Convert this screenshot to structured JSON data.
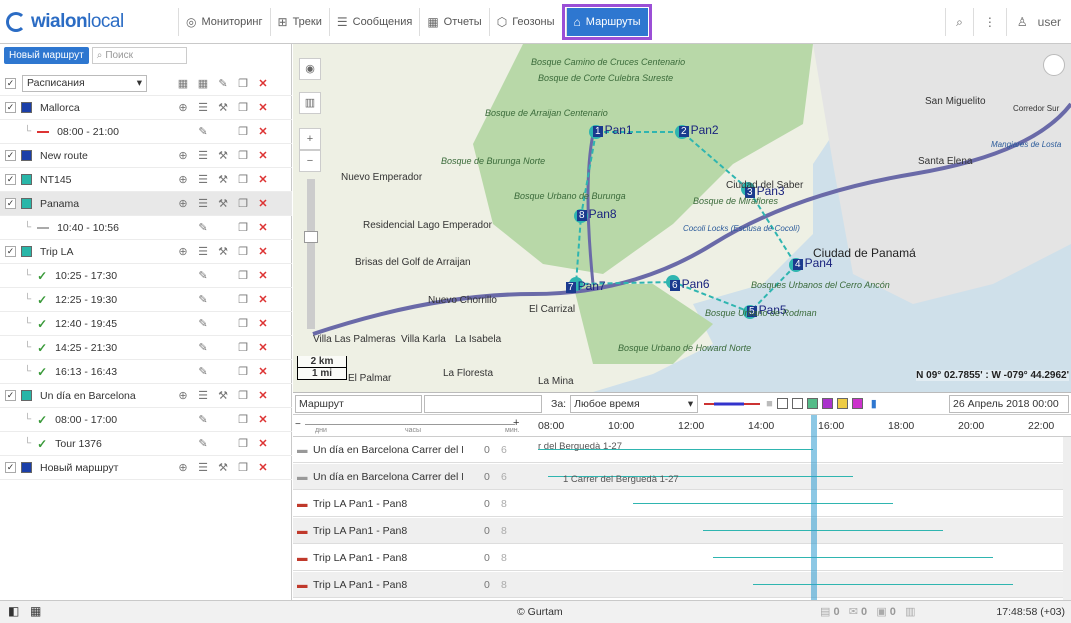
{
  "brand": {
    "name": "wialon",
    "suffix": "local",
    "accent": "#2e77d0",
    "highlight": "#9b4fd6"
  },
  "nav": {
    "tabs": [
      {
        "label": "Мониторинг",
        "icon": "globe-icon"
      },
      {
        "label": "Треки",
        "icon": "tracks-icon"
      },
      {
        "label": "Сообщения",
        "icon": "messages-icon"
      },
      {
        "label": "Отчеты",
        "icon": "reports-icon"
      },
      {
        "label": "Геозоны",
        "icon": "geofence-icon"
      },
      {
        "label": "Маршруты",
        "icon": "routes-icon",
        "active": true
      }
    ],
    "user": "user"
  },
  "panel": {
    "new_button": "Новый маршрут",
    "search_placeholder": "Поиск",
    "filter": "Расписания",
    "rows": [
      {
        "kind": "route",
        "name": "Mallorca",
        "color": "#1b3fa8"
      },
      {
        "kind": "sched",
        "time": "08:00 - 21:00",
        "mark": "red"
      },
      {
        "kind": "route",
        "name": "New route",
        "color": "#1b3fa8"
      },
      {
        "kind": "route",
        "name": "NT145",
        "color": "#29b6a8"
      },
      {
        "kind": "route",
        "name": "Panama",
        "color": "#29b6a8",
        "selected": true
      },
      {
        "kind": "sched",
        "time": "10:40 - 10:56",
        "mark": "gray"
      },
      {
        "kind": "route",
        "name": "Trip LA",
        "color": "#29b6a8"
      },
      {
        "kind": "sched",
        "time": "10:25 - 17:30",
        "mark": "tick"
      },
      {
        "kind": "sched",
        "time": "12:25 - 19:30",
        "mark": "tick"
      },
      {
        "kind": "sched",
        "time": "12:40 - 19:45",
        "mark": "tick"
      },
      {
        "kind": "sched",
        "time": "14:25 - 21:30",
        "mark": "tick"
      },
      {
        "kind": "sched",
        "time": "16:13 - 16:43",
        "mark": "tick"
      },
      {
        "kind": "route",
        "name": "Un día en Barcelona",
        "color": "#29b6a8"
      },
      {
        "kind": "sched",
        "time": "08:00 - 17:00",
        "mark": "tick"
      },
      {
        "kind": "sched",
        "time": "Tour 1376",
        "mark": "tick"
      },
      {
        "kind": "route",
        "name": "Новый маршрут",
        "color": "#1b3fa8"
      }
    ]
  },
  "map": {
    "labels": [
      "Pan1",
      "Pan2",
      "Pan3",
      "Pan4",
      "Pan5",
      "Pan6",
      "Pan7",
      "Pan8"
    ],
    "numbers": [
      "1",
      "2",
      "3",
      "4",
      "5",
      "6",
      "7",
      "8"
    ],
    "places": {
      "ciudad": "Ciudad de Panamá",
      "nuevo_emp": "Nuevo Emperador",
      "res_lago": "Residencial Lago Emperador",
      "brisas": "Brisas del Golf de Arraijan",
      "nuevo_chorrillo": "Nuevo Chorrillo",
      "carrizal": "El Carrizal",
      "villa_palmeras": "Villa Las Palmeras",
      "villa_karla": "Villa Karla",
      "la_isabela": "La Isabela",
      "el_palmar": "El Palmar",
      "la_floresta": "La Floresta",
      "la_mina": "La Mina",
      "san_miguelito": "San Miguelito",
      "santa_elena": "Santa Elena",
      "ciudad_del_saber": "Ciudad del Saber",
      "bosque1": "Bosque Camino de Cruces Centenario",
      "bosque2": "Bosque de Corte Culebra Sureste",
      "bosque3": "Bosque de Arraijan  Centenario",
      "bosque4": "Bosque de Burunga Norte",
      "bosque5": "Bosque Urbano de Burunga",
      "bosque6": "Bosque de Miraflores",
      "bosque7": "Bosques Urbanos del Cerro Ancón",
      "bosque8": "Bosque Urbano de Howard Norte",
      "bosque9": "Bosque Urbano de Rodman",
      "cocoli": "Cocoli Locks (Esclusa de Cocolí)",
      "corredor_sur": "Corredor Sur",
      "mangiares": "Mangiares de Losta"
    },
    "scale_km": "2 km",
    "scale_mi": "1 mi",
    "coords": "N 09° 02.7855' : W -079° 44.2962'"
  },
  "timeline": {
    "route_select": "Маршрут",
    "za": "За:",
    "period": "Любое время",
    "date": "26 Апрель 2018 00:00",
    "zoom_labels": [
      "дни",
      "часы",
      "мин."
    ],
    "hours": [
      "08:00",
      "10:00",
      "12:00",
      "14:00",
      "16:00",
      "18:00",
      "20:00",
      "22:00"
    ],
    "rows": [
      {
        "name": "Un día en Barcelona Carrer del Berg",
        "n0": "0",
        "n1": "6",
        "car": "gray",
        "label": "r del Berguedà 1-27"
      },
      {
        "name": "Un día en Barcelona Carrer del Berg",
        "n0": "0",
        "n1": "6",
        "car": "gray",
        "label": "1 Carrer del Berguedà 1-27"
      },
      {
        "name": "Trip LA Pan1 - Pan8",
        "n0": "0",
        "n1": "8",
        "car": "red",
        "label": ""
      },
      {
        "name": "Trip LA Pan1 - Pan8",
        "n0": "0",
        "n1": "8",
        "car": "red",
        "label": ""
      },
      {
        "name": "Trip LA Pan1 - Pan8",
        "n0": "0",
        "n1": "8",
        "car": "red",
        "label": ""
      },
      {
        "name": "Trip LA Pan1 - Pan8",
        "n0": "0",
        "n1": "8",
        "car": "red",
        "label": ""
      }
    ]
  },
  "footer": {
    "copyright": "© Gurtam",
    "time": "17:48:58 (+03)",
    "c1": "0",
    "c2": "0",
    "c3": "0"
  }
}
